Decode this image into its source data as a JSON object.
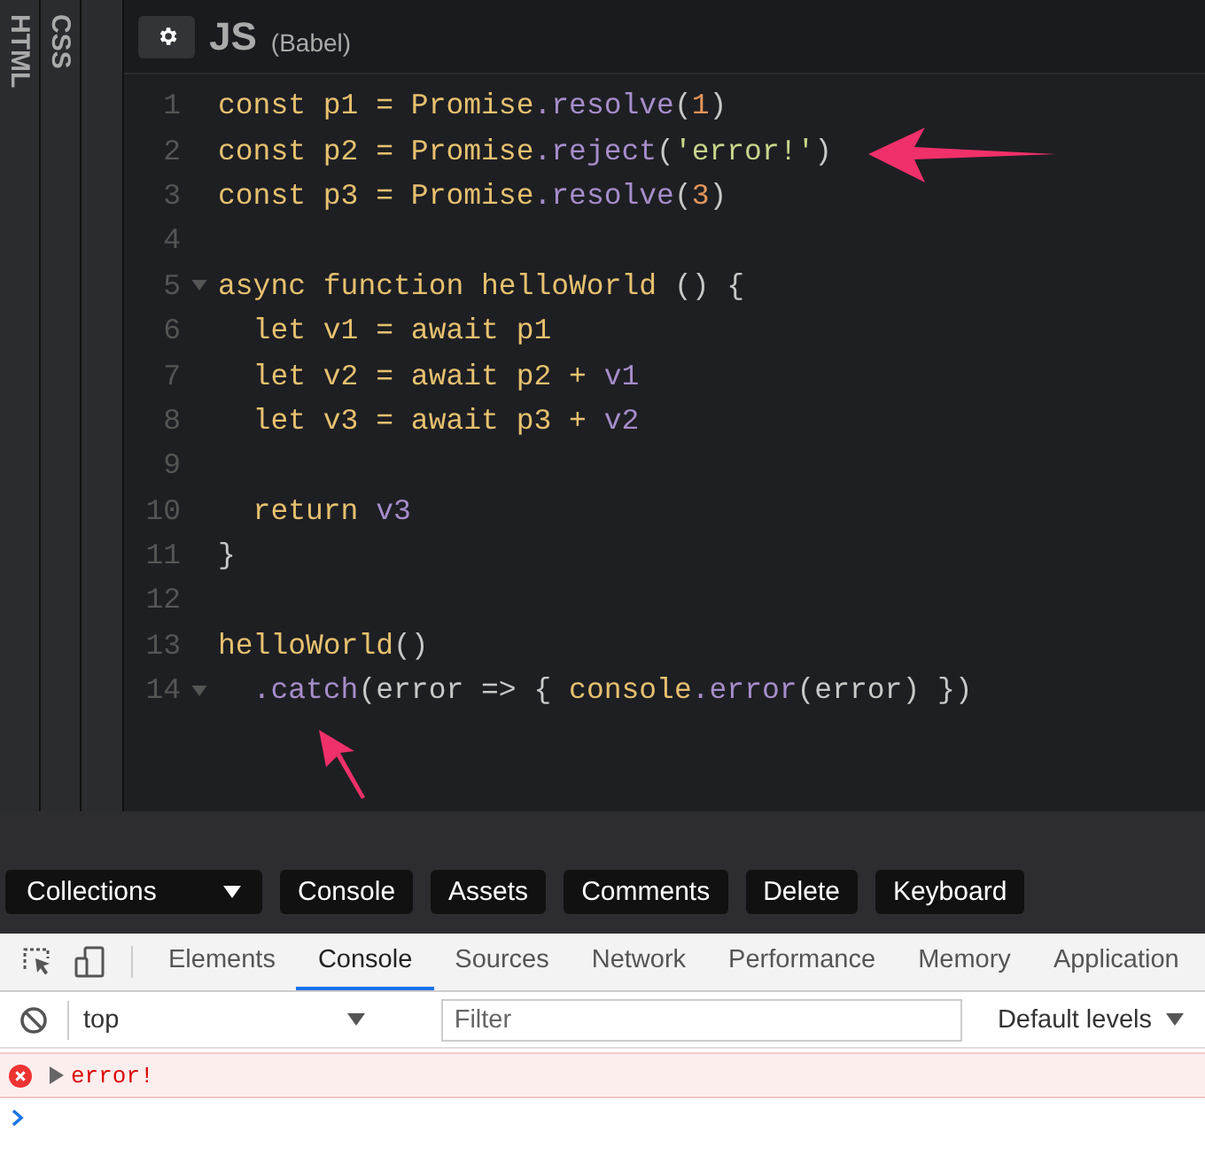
{
  "side_tabs": [
    {
      "label": "HTML"
    },
    {
      "label": "CSS"
    }
  ],
  "editor": {
    "title": "JS",
    "subtitle": "(Babel)",
    "lines": [
      {
        "number": "1",
        "foldable": false,
        "tokens": [
          {
            "kind": "keyword",
            "text": "const p1 = Promise"
          },
          {
            "kind": "member",
            "text": ".resolve"
          },
          {
            "kind": "punct",
            "text": "("
          },
          {
            "kind": "number",
            "text": "1"
          },
          {
            "kind": "punct",
            "text": ")"
          }
        ]
      },
      {
        "number": "2",
        "foldable": false,
        "tokens": [
          {
            "kind": "keyword",
            "text": "const p2 = Promise"
          },
          {
            "kind": "member",
            "text": ".reject"
          },
          {
            "kind": "punct",
            "text": "("
          },
          {
            "kind": "string",
            "text": "'error!'"
          },
          {
            "kind": "punct",
            "text": ")"
          }
        ]
      },
      {
        "number": "3",
        "foldable": false,
        "tokens": [
          {
            "kind": "keyword",
            "text": "const p3 = Promise"
          },
          {
            "kind": "member",
            "text": ".resolve"
          },
          {
            "kind": "punct",
            "text": "("
          },
          {
            "kind": "number",
            "text": "3"
          },
          {
            "kind": "punct",
            "text": ")"
          }
        ]
      },
      {
        "number": "4",
        "foldable": false
      },
      {
        "number": "5",
        "foldable": true,
        "tokens": [
          {
            "kind": "keyword",
            "text": "async function helloWorld"
          },
          {
            "kind": "punct",
            "text": " () {"
          }
        ]
      },
      {
        "number": "6",
        "foldable": false,
        "tokens": [
          {
            "kind": "keyword",
            "text": "  let v1 = await p1"
          }
        ]
      },
      {
        "number": "7",
        "foldable": false,
        "tokens": [
          {
            "kind": "keyword",
            "text": "  let v2 = await p2 + "
          },
          {
            "kind": "member",
            "text": "v1"
          }
        ]
      },
      {
        "number": "8",
        "foldable": false,
        "tokens": [
          {
            "kind": "keyword",
            "text": "  let v3 = await p3 + "
          },
          {
            "kind": "member",
            "text": "v2"
          }
        ]
      },
      {
        "number": "9",
        "foldable": false
      },
      {
        "number": "10",
        "foldable": false,
        "tokens": [
          {
            "kind": "keyword",
            "text": "  return "
          },
          {
            "kind": "member",
            "text": "v3"
          }
        ]
      },
      {
        "number": "11",
        "foldable": false,
        "tokens": [
          {
            "kind": "punct",
            "text": "}"
          }
        ]
      },
      {
        "number": "12",
        "foldable": false
      },
      {
        "number": "13",
        "foldable": false,
        "tokens": [
          {
            "kind": "keyword",
            "text": "helloWorld"
          },
          {
            "kind": "punct",
            "text": "()"
          }
        ]
      },
      {
        "number": "14",
        "foldable": true,
        "tokens": [
          {
            "kind": "member",
            "text": "  .catch"
          },
          {
            "kind": "punct",
            "text": "(error => { "
          },
          {
            "kind": "keyword",
            "text": "console"
          },
          {
            "kind": "member",
            "text": ".error"
          },
          {
            "kind": "punct",
            "text": "(error) })"
          }
        ]
      }
    ]
  },
  "toolbar": {
    "dropdown": "Collections",
    "buttons": [
      "Console",
      "Assets",
      "Comments",
      "Delete",
      "Keyboard"
    ]
  },
  "devtools": {
    "tabs": [
      {
        "label": "Elements",
        "selected": false
      },
      {
        "label": "Console",
        "selected": true
      },
      {
        "label": "Sources",
        "selected": false
      },
      {
        "label": "Network",
        "selected": false
      },
      {
        "label": "Performance",
        "selected": false
      },
      {
        "label": "Memory",
        "selected": false
      },
      {
        "label": "Application",
        "selected": false
      }
    ],
    "context": "top",
    "filter": {
      "placeholder": "Filter"
    },
    "levels": "Default levels",
    "messages": [
      {
        "kind": "error",
        "text": "error!"
      }
    ]
  }
}
